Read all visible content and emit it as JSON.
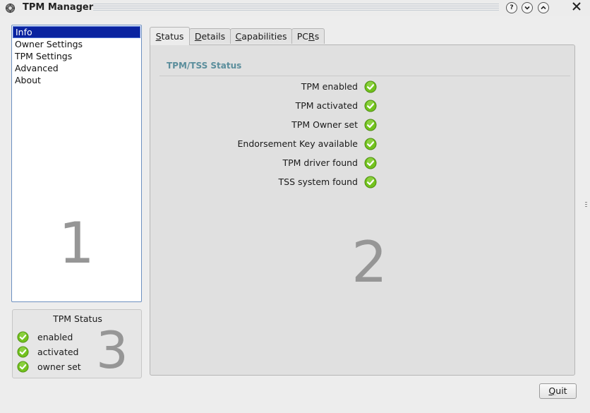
{
  "window": {
    "title": "TPM Manager",
    "help_label": "?",
    "app_icon": "gear-icon"
  },
  "sidebar": {
    "items": [
      {
        "label": "Info",
        "selected": true
      },
      {
        "label": "Owner Settings"
      },
      {
        "label": "TPM Settings"
      },
      {
        "label": "Advanced"
      },
      {
        "label": "About"
      }
    ],
    "marker": "1"
  },
  "tpm_status_box": {
    "title": "TPM Status",
    "items": [
      {
        "label": "enabled",
        "icon": "check-icon"
      },
      {
        "label": "activated",
        "icon": "check-icon"
      },
      {
        "label": "owner set",
        "icon": "check-icon"
      }
    ],
    "marker": "3"
  },
  "tabs": [
    {
      "label": "Status",
      "mnemonic": "S",
      "rest": "tatus",
      "active": true
    },
    {
      "label": "Details",
      "mnemonic": "D",
      "rest": "etails"
    },
    {
      "label": "Capabilities",
      "mnemonic": "C",
      "rest": "apabilities"
    },
    {
      "label": "PCRs",
      "pre": "PC",
      "mnemonic": "R",
      "rest": "s"
    }
  ],
  "status_panel": {
    "section_title": "TPM/TSS Status",
    "rows": [
      {
        "label": "TPM enabled",
        "icon": "check-icon"
      },
      {
        "label": "TPM activated",
        "icon": "check-icon"
      },
      {
        "label": "TPM Owner set",
        "icon": "check-icon"
      },
      {
        "label": "Endorsement Key available",
        "icon": "check-icon"
      },
      {
        "label": "TPM driver found",
        "icon": "check-icon"
      },
      {
        "label": "TSS system found",
        "icon": "check-icon"
      }
    ],
    "marker": "2"
  },
  "footer": {
    "quit_label": "Quit",
    "quit_mnemonic": "Q",
    "quit_rest": "uit"
  },
  "colors": {
    "selection": "#0a23a0",
    "section_title": "#5b8e9c",
    "check_green": "#6fbf1f"
  }
}
